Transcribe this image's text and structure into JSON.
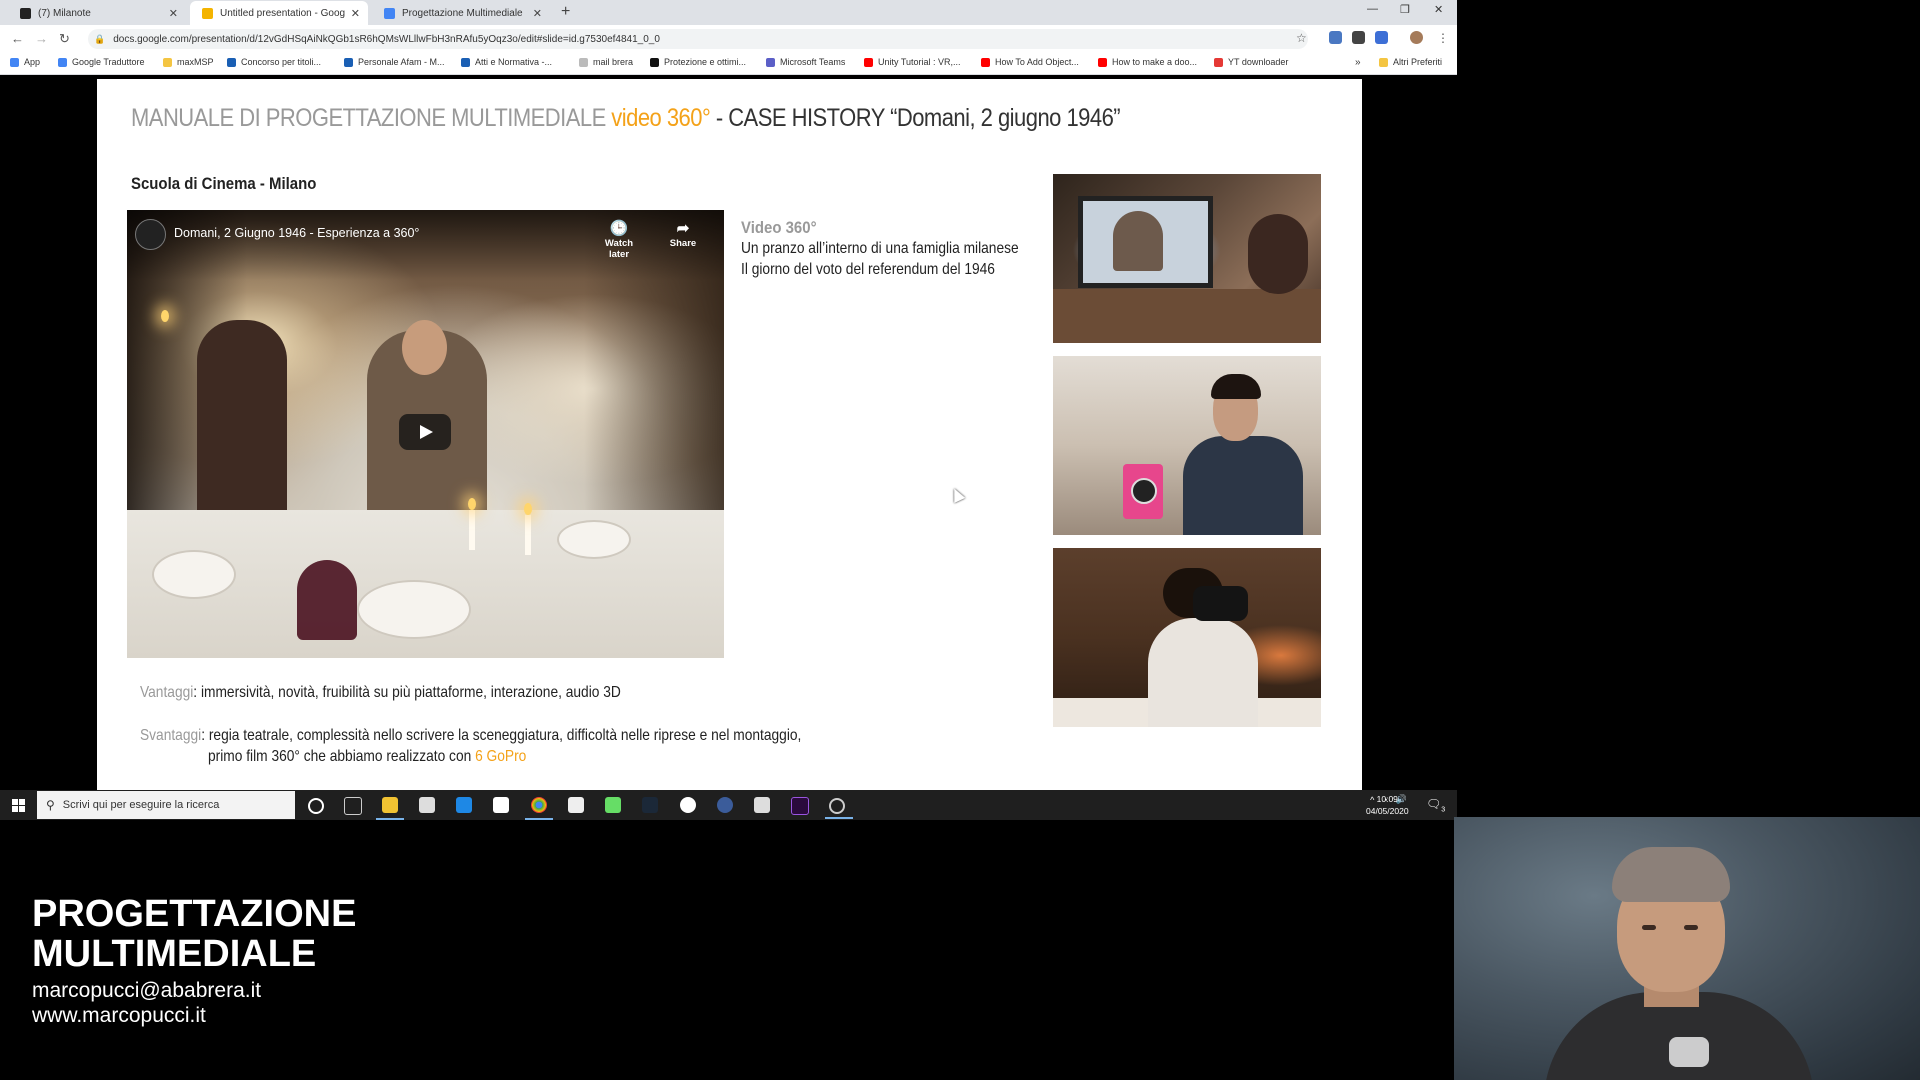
{
  "browser": {
    "tabs": [
      {
        "title": "(7) Milanote",
        "icon_color": "#222222",
        "active": false
      },
      {
        "title": "Untitled presentation - Google S",
        "icon_color": "#f4b400",
        "active": true
      },
      {
        "title": "Progettazione Multimediale",
        "icon_color": "#4285f4",
        "active": false
      }
    ],
    "new_tab": "+",
    "url": "docs.google.com/presentation/d/12vGdHSqAiNkQGb1sR6hQMsWLllwFbH3nRAfu5yOqz3o/edit#slide=id.g7530ef4841_0_0",
    "bookmarks": [
      {
        "label": "App",
        "icon_color": "#4285f4"
      },
      {
        "label": "Google Traduttore",
        "icon_color": "#4285f4"
      },
      {
        "label": "maxMSP",
        "icon_color": "#f4c542"
      },
      {
        "label": "Concorso per titoli...",
        "icon_color": "#1a5fb4"
      },
      {
        "label": "Personale Afam - M...",
        "icon_color": "#1a5fb4"
      },
      {
        "label": "Atti e Normativa -...",
        "icon_color": "#1a5fb4"
      },
      {
        "label": "mail brera",
        "icon_color": "#bbbbbb"
      },
      {
        "label": "Protezione e ottimi...",
        "icon_color": "#111111"
      },
      {
        "label": "Microsoft Teams",
        "icon_color": "#5b5fc7"
      },
      {
        "label": "Unity Tutorial : VR,...",
        "icon_color": "#ff0000"
      },
      {
        "label": "How To Add Object...",
        "icon_color": "#ff0000"
      },
      {
        "label": "How to make a doo...",
        "icon_color": "#ff0000"
      },
      {
        "label": "YT downloader",
        "icon_color": "#e53935"
      },
      {
        "label": "Altri Preferiti",
        "icon_color": "#f4c542"
      }
    ],
    "more_bookmarks": "»"
  },
  "slide": {
    "title_part1": "MANUALE DI PROGETTAZIONE MULTIMEDIALE ",
    "title_part2": "video 360°",
    "title_part3": " - CASE HISTORY “Domani, 2 giugno 1946”",
    "subtitle": "Scuola di Cinema - Milano",
    "video": {
      "title": "Domani, 2 Giugno 1946 - Esperienza a 360°",
      "watch_later": "Watch later",
      "share": "Share"
    },
    "desc_heading": "Video 360°",
    "desc_line1": "Un pranzo all’interno di una famiglia milanese",
    "desc_line2": "Il giorno del voto del referendum del 1946",
    "vantaggi_label": "Vantaggi",
    "vantaggi_text": ": immersività, novità, fruibilità su più piattaforme, interazione, audio 3D",
    "svantaggi_label": "Svantaggi",
    "svantaggi_text": ": regia teatrale, complessità nello scrivere la sceneggiatura, difficoltà nelle riprese e nel montaggio,",
    "svantaggi_line2": "primo film 360° che abbiamo realizzato con ",
    "svantaggi_highlight": "6 GoPro",
    "colors": {
      "accent": "#f4a219",
      "muted": "#999999"
    }
  },
  "taskbar": {
    "search_placeholder": "Scrivi qui per eseguire la ricerca",
    "clock_time": "10:09",
    "clock_date": "04/05/2020",
    "notification_count": "3"
  },
  "overlay": {
    "brand_line1": "PROGETTAZIONE",
    "brand_line2": "MULTIMEDIALE",
    "email": "marcopucci@ababrera.it",
    "website": "www.marcopucci.it"
  }
}
